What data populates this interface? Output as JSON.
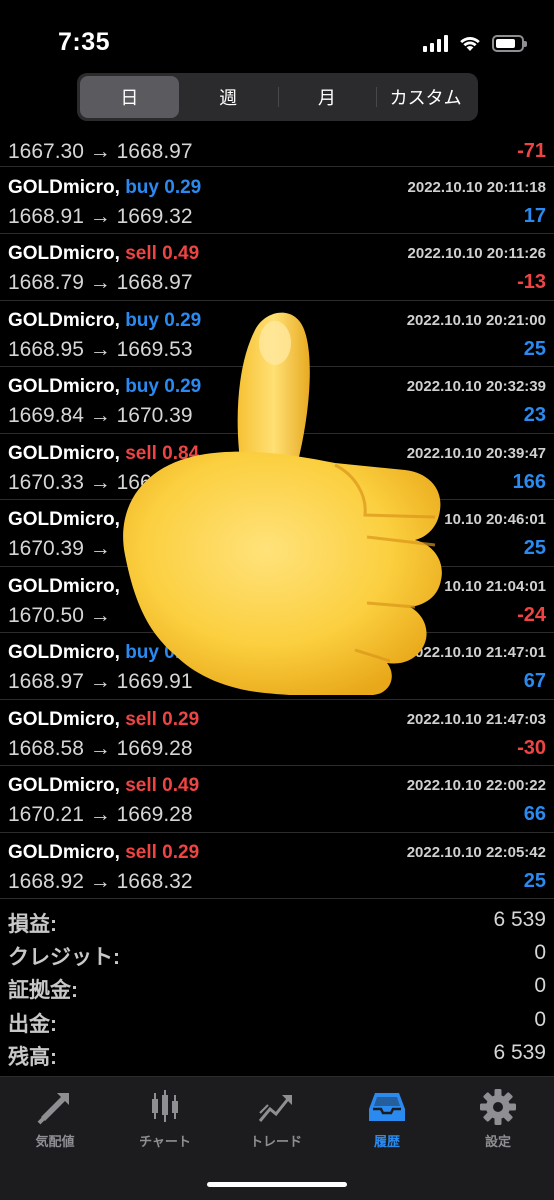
{
  "status_bar": {
    "time": "7:35"
  },
  "period_tabs": [
    {
      "label": "日",
      "active": true
    },
    {
      "label": "週",
      "active": false
    },
    {
      "label": "月",
      "active": false
    },
    {
      "label": "カスタム",
      "active": false
    }
  ],
  "trades": [
    {
      "symbol": "",
      "side": "",
      "volume": "",
      "datetime": "",
      "open_price": "1667.30",
      "close_price": "1668.97",
      "profit": "-71"
    },
    {
      "symbol": "GOLDmicro,",
      "side": "buy",
      "volume": "0.29",
      "datetime": "2022.10.10 20:11:18",
      "open_price": "1668.91",
      "close_price": "1669.32",
      "profit": "17"
    },
    {
      "symbol": "GOLDmicro,",
      "side": "sell",
      "volume": "0.49",
      "datetime": "2022.10.10 20:11:26",
      "open_price": "1668.79",
      "close_price": "1668.97",
      "profit": "-13"
    },
    {
      "symbol": "GOLDmicro,",
      "side": "buy",
      "volume": "0.29",
      "datetime": "2022.10.10 20:21:00",
      "open_price": "1668.95",
      "close_price": "1669.53",
      "profit": "25"
    },
    {
      "symbol": "GOLDmicro,",
      "side": "buy",
      "volume": "0.29",
      "datetime": "2022.10.10 20:32:39",
      "open_price": "1669.84",
      "close_price": "1670.39",
      "profit": "23"
    },
    {
      "symbol": "GOLDmicro,",
      "side": "sell",
      "volume": "0.84",
      "datetime": "2022.10.10 20:39:47",
      "open_price": "1670.33",
      "close_price": "1668.",
      "profit": "166"
    },
    {
      "symbol": "GOLDmicro,",
      "side": "",
      "volume": "",
      "datetime": "10.10 20:46:01",
      "open_price": "1670.39",
      "close_price": "",
      "profit": "25"
    },
    {
      "symbol": "GOLDmicro,",
      "side": "",
      "volume": "",
      "datetime": "10.10 21:04:01",
      "open_price": "1670.50",
      "close_price": "",
      "profit": "-24"
    },
    {
      "symbol": "GOLDmicro,",
      "side": "buy",
      "volume": "0.49",
      "datetime": "2022.10.10 21:47:01",
      "open_price": "1668.97",
      "close_price": "1669.91",
      "profit": "67"
    },
    {
      "symbol": "GOLDmicro,",
      "side": "sell",
      "volume": "0.29",
      "datetime": "2022.10.10 21:47:03",
      "open_price": "1668.58",
      "close_price": "1669.28",
      "profit": "-30"
    },
    {
      "symbol": "GOLDmicro,",
      "side": "sell",
      "volume": "0.49",
      "datetime": "2022.10.10 22:00:22",
      "open_price": "1670.21",
      "close_price": "1669.28",
      "profit": "66"
    },
    {
      "symbol": "GOLDmicro,",
      "side": "sell",
      "volume": "0.29",
      "datetime": "2022.10.10 22:05:42",
      "open_price": "1668.92",
      "close_price": "1668.32",
      "profit": "25"
    }
  ],
  "summary": [
    {
      "label": "損益:",
      "value": "6 539"
    },
    {
      "label": "クレジット:",
      "value": "0"
    },
    {
      "label": "証拠金:",
      "value": "0"
    },
    {
      "label": "出金:",
      "value": "0"
    },
    {
      "label": "残高:",
      "value": "6 539"
    }
  ],
  "tab_bar": [
    {
      "label": "気配値",
      "icon": "arrows-icon",
      "active": false
    },
    {
      "label": "チャート",
      "icon": "candlestick-icon",
      "active": false
    },
    {
      "label": "トレード",
      "icon": "trade-chart-icon",
      "active": false
    },
    {
      "label": "履歴",
      "icon": "inbox-icon",
      "active": true
    },
    {
      "label": "設定",
      "icon": "gear-icon",
      "active": false
    }
  ],
  "colors": {
    "buy": "#2a8af0",
    "sell": "#ee4444",
    "active_tab": "#2a8af0",
    "inactive_tab": "#8e8e93"
  },
  "overlay": {
    "icon": "thumbs-up-emoji-icon"
  }
}
